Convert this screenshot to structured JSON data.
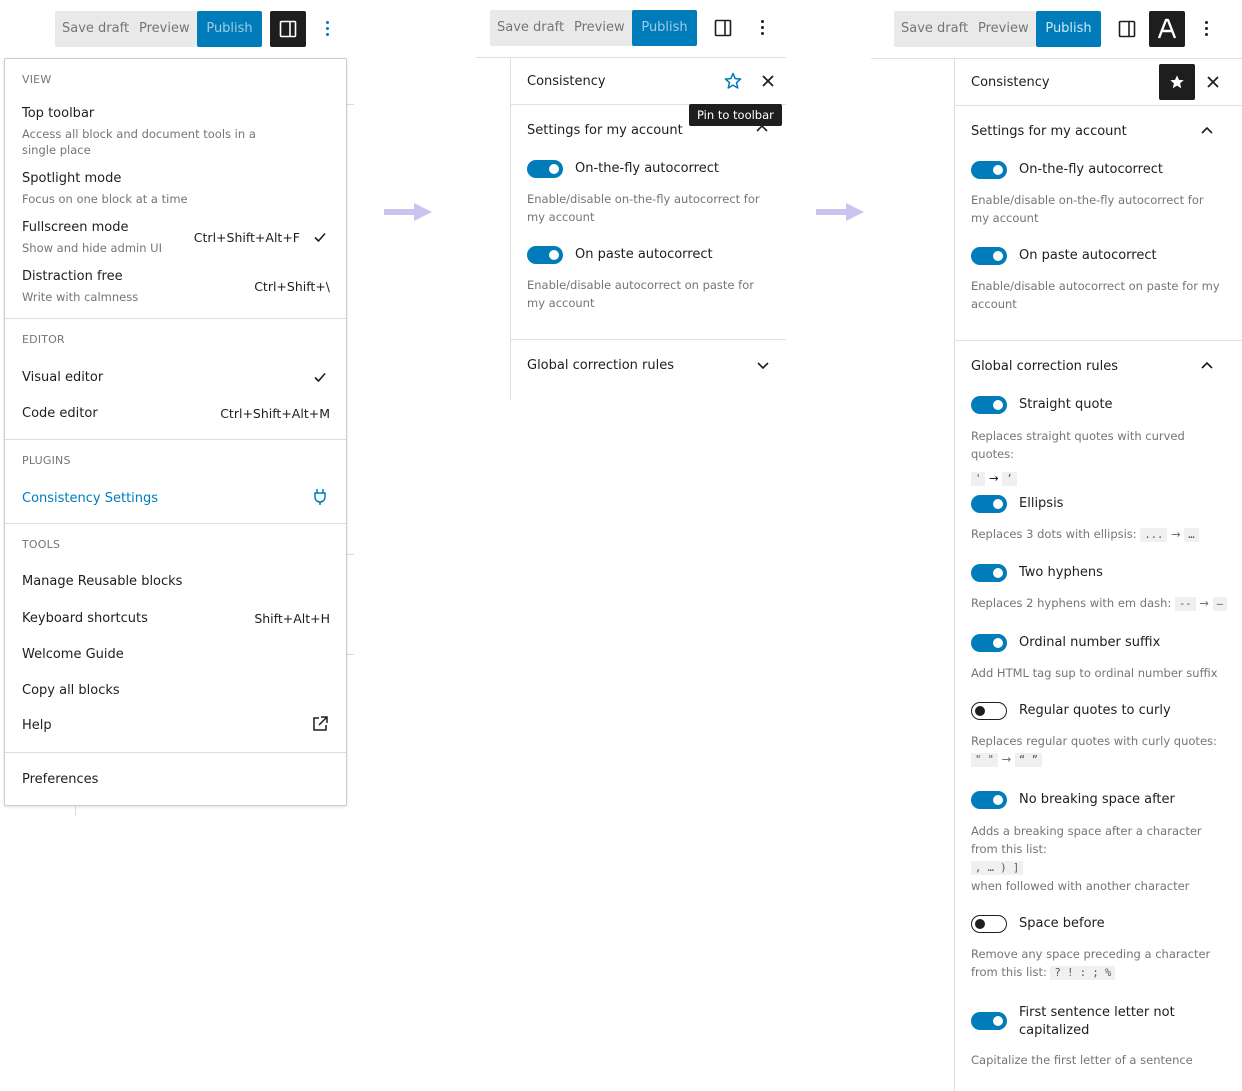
{
  "toolbar": {
    "save_draft": "Save draft",
    "preview": "Preview",
    "publish": "Publish"
  },
  "menu": {
    "view_heading": "VIEW",
    "top_toolbar": "Top toolbar",
    "top_toolbar_desc": "Access all block and document tools in a single place",
    "spotlight": "Spotlight mode",
    "spotlight_desc": "Focus on one block at a time",
    "fullscreen": "Fullscreen mode",
    "fullscreen_desc": "Show and hide admin UI",
    "fullscreen_shortcut": "Ctrl+Shift+Alt+F",
    "distraction": "Distraction free",
    "distraction_desc": "Write with calmness",
    "distraction_shortcut": "Ctrl+Shift+\\",
    "editor_heading": "EDITOR",
    "visual_editor": "Visual editor",
    "code_editor": "Code editor",
    "code_editor_shortcut": "Ctrl+Shift+Alt+M",
    "plugins_heading": "PLUGINS",
    "consistency_settings": "Consistency Settings",
    "tools_heading": "TOOLS",
    "manage_reusable": "Manage Reusable blocks",
    "keyboard_shortcuts": "Keyboard shortcuts",
    "keyboard_shortcuts_key": "Shift+Alt+H",
    "welcome_guide": "Welcome Guide",
    "copy_all": "Copy all blocks",
    "help": "Help",
    "preferences": "Preferences"
  },
  "panel": {
    "title": "Consistency",
    "tooltip": "Pin to toolbar",
    "account_section": "Settings for my account",
    "onthefly": "On-the-fly autocorrect",
    "onthefly_desc": "Enable/disable on-the-fly autocorrect for my account",
    "onpaste": "On paste autocorrect",
    "onpaste_desc": "Enable/disable autocorrect on paste for my account",
    "global_section": "Global correction rules"
  },
  "rules": {
    "straight_quote": "Straight quote",
    "straight_quote_desc": "Replaces straight quotes with curved quotes:",
    "straight_from": "'",
    "straight_arrow": "→",
    "straight_to": "’",
    "ellipsis": "Ellipsis",
    "ellipsis_desc": "Replaces 3 dots with ellipsis:",
    "ellipsis_from": "...",
    "ellipsis_arrow": "→",
    "ellipsis_to": "…",
    "two_hyphens": "Two hyphens",
    "two_hyphens_desc": "Replaces 2 hyphens with em dash:",
    "hyphen_from": "--",
    "hyphen_arrow": "→",
    "hyphen_to": "—",
    "ordinal": "Ordinal number suffix",
    "ordinal_desc": "Add HTML tag sup to ordinal number suffix",
    "regular_quotes": "Regular quotes to curly",
    "regular_quotes_desc": "Replaces regular quotes with curly quotes:",
    "rq_from": "\" \"",
    "rq_arrow": "→",
    "rq_to": "“ ”",
    "nbsp_after": "No breaking space after",
    "nbsp_after_desc": "Adds a breaking space after a character from this list:",
    "nbsp_list": ", … ) ]",
    "nbsp_after_tail": "when followed with another character",
    "space_before": "Space before",
    "space_before_desc": "Remove any space preceding a character from this list:",
    "space_before_list": "? ! : ; %",
    "first_letter": "First sentence letter not capitalized",
    "first_letter_desc": "Capitalize the first letter of a sentence"
  },
  "colors": {
    "accent": "#007cba",
    "dark": "#1e1e1e",
    "arrow": "#c9c3ee"
  },
  "icons": [
    "sidebar-toggle-icon",
    "kebab-menu-icon",
    "check-icon",
    "plug-icon",
    "external-link-icon",
    "star-icon",
    "close-icon",
    "chevron-down-icon",
    "chevron-up-icon",
    "consistency-logo-icon",
    "right-arrow-icon"
  ]
}
